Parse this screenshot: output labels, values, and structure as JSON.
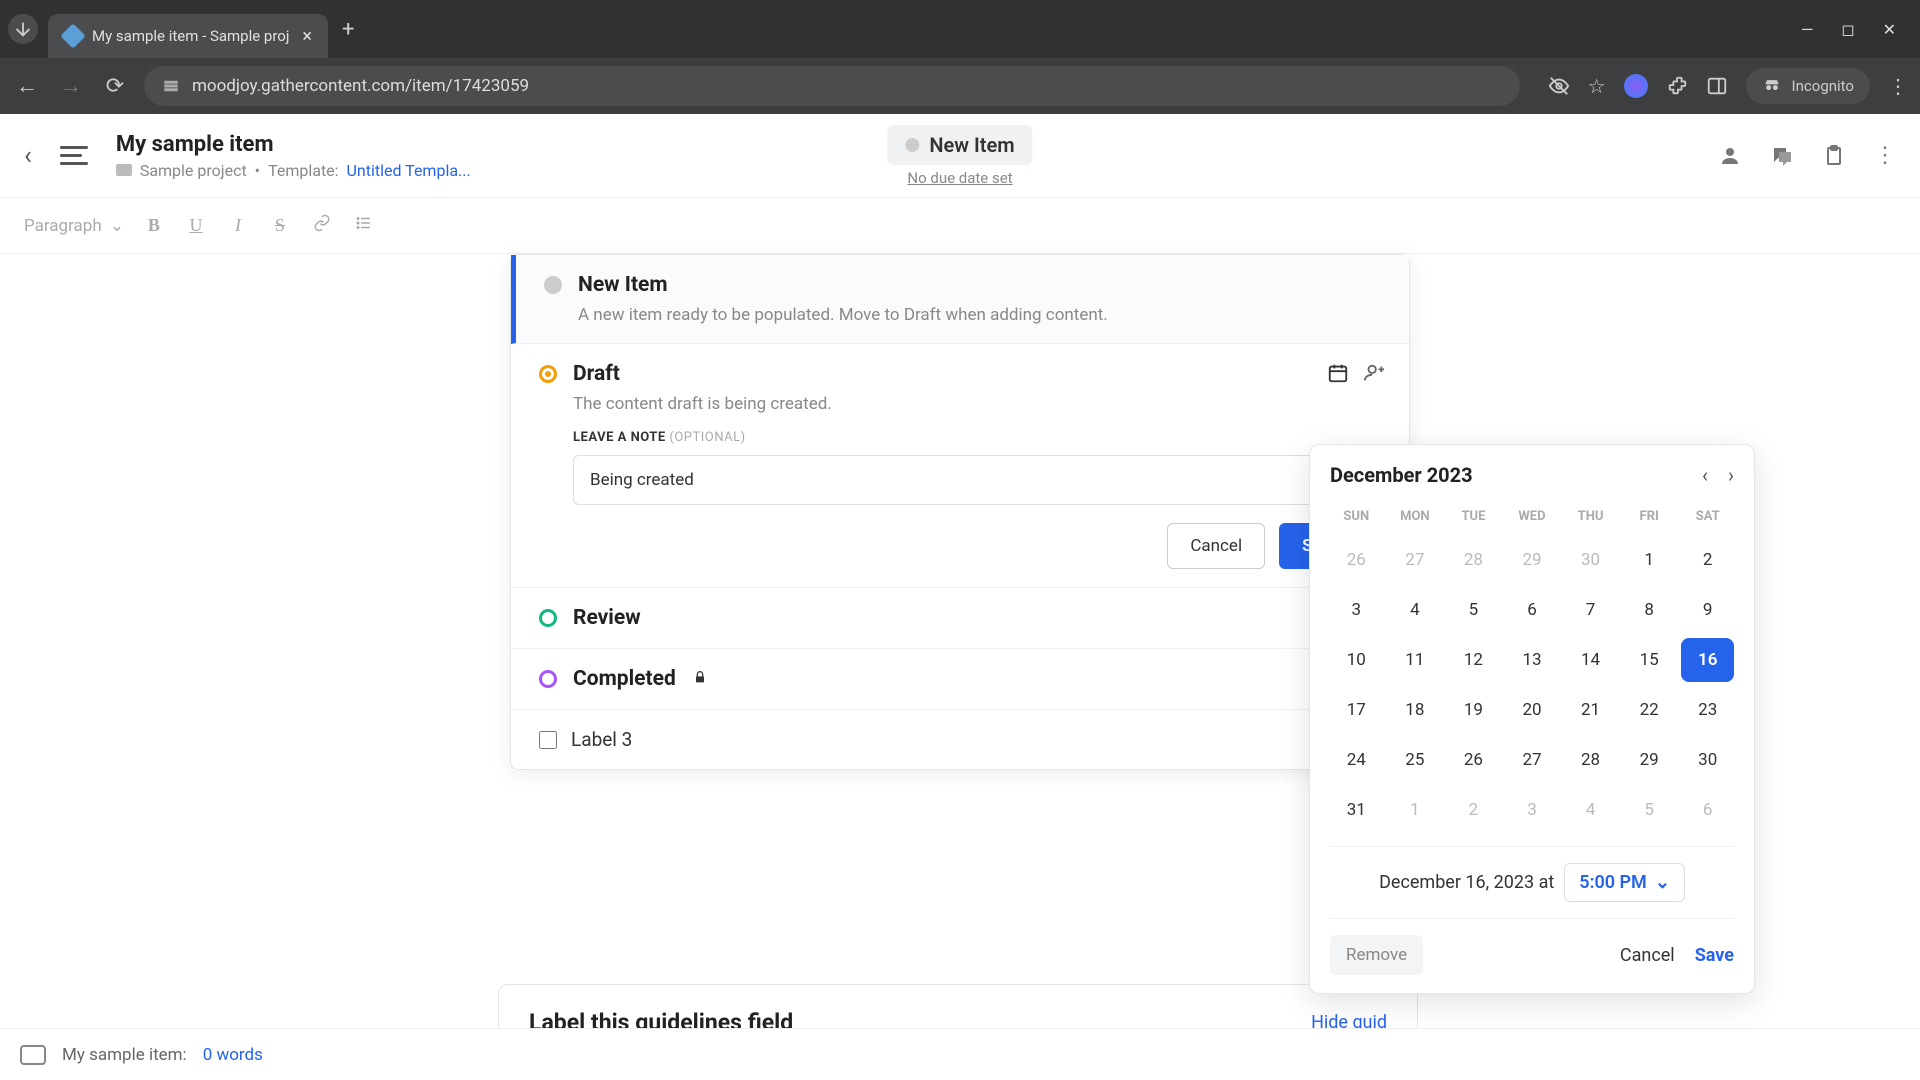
{
  "browser": {
    "tab_title": "My sample item - Sample proj",
    "url": "moodjoy.gathercontent.com/item/17423059",
    "incognito": "Incognito"
  },
  "header": {
    "title": "My sample item",
    "project": "Sample project",
    "template_prefix": "Template:",
    "template_name": "Untitled Templa...",
    "status_label": "New Item",
    "due_text": "No due date set"
  },
  "toolbar": {
    "paragraph": "Paragraph",
    "bold": "B",
    "underline": "U",
    "italic": "I",
    "strike": "S",
    "link": "🔗"
  },
  "workflow": {
    "items": [
      {
        "title": "New Item",
        "desc": "A new item ready to be populated. Move to Draft when adding content."
      },
      {
        "title": "Draft",
        "desc": "The content draft is being created."
      },
      {
        "title": "Review",
        "desc": ""
      },
      {
        "title": "Completed",
        "desc": ""
      }
    ],
    "note_label": "LEAVE A NOTE",
    "note_optional": "(OPTIONAL)",
    "note_value": "Being created",
    "cancel": "Cancel",
    "set_status": "Set st",
    "label3": "Label 3"
  },
  "datepicker": {
    "month": "December 2023",
    "dow": [
      "SUN",
      "MON",
      "TUE",
      "WED",
      "THU",
      "FRI",
      "SAT"
    ],
    "weeks": [
      [
        {
          "n": 26,
          "m": true
        },
        {
          "n": 27,
          "m": true
        },
        {
          "n": 28,
          "m": true
        },
        {
          "n": 29,
          "m": true
        },
        {
          "n": 30,
          "m": true
        },
        {
          "n": 1
        },
        {
          "n": 2
        }
      ],
      [
        {
          "n": 3
        },
        {
          "n": 4
        },
        {
          "n": 5
        },
        {
          "n": 6
        },
        {
          "n": 7
        },
        {
          "n": 8
        },
        {
          "n": 9
        }
      ],
      [
        {
          "n": 10
        },
        {
          "n": 11
        },
        {
          "n": 12
        },
        {
          "n": 13
        },
        {
          "n": 14
        },
        {
          "n": 15
        },
        {
          "n": 16,
          "sel": true
        }
      ],
      [
        {
          "n": 17
        },
        {
          "n": 18
        },
        {
          "n": 19
        },
        {
          "n": 20
        },
        {
          "n": 21
        },
        {
          "n": 22
        },
        {
          "n": 23
        }
      ],
      [
        {
          "n": 24
        },
        {
          "n": 25
        },
        {
          "n": 26
        },
        {
          "n": 27
        },
        {
          "n": 28
        },
        {
          "n": 29
        },
        {
          "n": 30
        }
      ],
      [
        {
          "n": 31
        },
        {
          "n": 1,
          "m": true
        },
        {
          "n": 2,
          "m": true
        },
        {
          "n": 3,
          "m": true
        },
        {
          "n": 4,
          "m": true
        },
        {
          "n": 5,
          "m": true
        },
        {
          "n": 6,
          "m": true
        }
      ]
    ],
    "date_text": "December 16, 2023 at",
    "time": "5:00 PM",
    "remove": "Remove",
    "cancel": "Cancel",
    "save": "Save"
  },
  "guidelines": {
    "title": "Label this guidelines field",
    "hide": "Hide guid"
  },
  "status": {
    "prefix": "My sample item:",
    "words": "0 words"
  }
}
